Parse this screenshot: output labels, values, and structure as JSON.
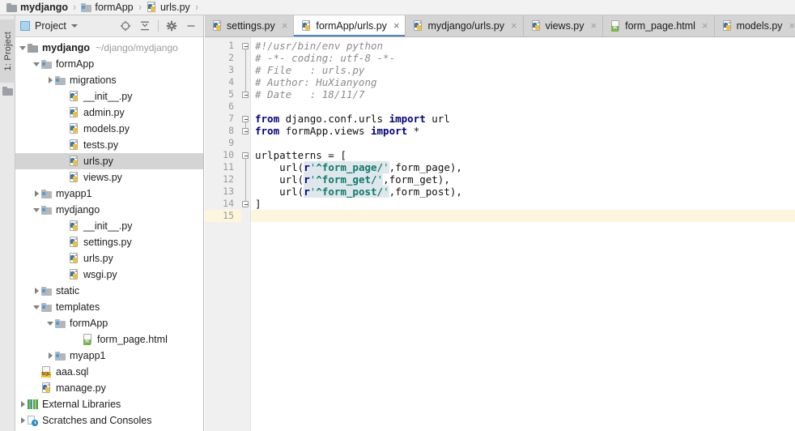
{
  "breadcrumb": {
    "name": "breadcrumb",
    "items": [
      {
        "label": "mydjango",
        "icon": "folder-icon",
        "bold": true
      },
      {
        "label": "formApp",
        "icon": "module-folder-icon",
        "bold": false
      },
      {
        "label": "urls.py",
        "icon": "python-file-icon",
        "bold": false
      }
    ],
    "separator": "›"
  },
  "toolwindow": {
    "vertical_tab_label": "1: Project",
    "vertical_tab_icon": "folder-icon"
  },
  "project_panel": {
    "title": "Project",
    "dropdown_icon": "chevron-down-icon",
    "tools": [
      {
        "name": "locate-icon",
        "title": "Select Opened File"
      },
      {
        "name": "collapse-all-icon",
        "title": "Collapse All"
      },
      {
        "name": "gear-icon",
        "title": "Settings"
      },
      {
        "name": "minimize-icon",
        "title": "Hide"
      }
    ],
    "tree": [
      {
        "indent": 0,
        "arrow": "down",
        "icon": "folder-icon",
        "label": "mydjango",
        "bold": true,
        "path": "~/django/mydjango",
        "selected": false
      },
      {
        "indent": 1,
        "arrow": "down",
        "icon": "module-folder-icon",
        "label": "formApp",
        "bold": false,
        "path": "",
        "selected": false
      },
      {
        "indent": 2,
        "arrow": "right",
        "icon": "module-folder-icon",
        "label": "migrations",
        "bold": false,
        "path": "",
        "selected": false
      },
      {
        "indent": 3,
        "arrow": "none",
        "icon": "python-file-icon",
        "label": "__init__.py",
        "bold": false,
        "path": "",
        "selected": false
      },
      {
        "indent": 3,
        "arrow": "none",
        "icon": "python-file-icon",
        "label": "admin.py",
        "bold": false,
        "path": "",
        "selected": false
      },
      {
        "indent": 3,
        "arrow": "none",
        "icon": "python-file-icon",
        "label": "models.py",
        "bold": false,
        "path": "",
        "selected": false
      },
      {
        "indent": 3,
        "arrow": "none",
        "icon": "python-file-icon",
        "label": "tests.py",
        "bold": false,
        "path": "",
        "selected": false
      },
      {
        "indent": 3,
        "arrow": "none",
        "icon": "python-file-icon",
        "label": "urls.py",
        "bold": false,
        "path": "",
        "selected": true
      },
      {
        "indent": 3,
        "arrow": "none",
        "icon": "python-file-icon",
        "label": "views.py",
        "bold": false,
        "path": "",
        "selected": false
      },
      {
        "indent": 1,
        "arrow": "right",
        "icon": "module-folder-icon",
        "label": "myapp1",
        "bold": false,
        "path": "",
        "selected": false
      },
      {
        "indent": 1,
        "arrow": "down",
        "icon": "module-folder-icon",
        "label": "mydjango",
        "bold": false,
        "path": "",
        "selected": false
      },
      {
        "indent": 3,
        "arrow": "none",
        "icon": "python-file-icon",
        "label": "__init__.py",
        "bold": false,
        "path": "",
        "selected": false
      },
      {
        "indent": 3,
        "arrow": "none",
        "icon": "python-file-icon",
        "label": "settings.py",
        "bold": false,
        "path": "",
        "selected": false
      },
      {
        "indent": 3,
        "arrow": "none",
        "icon": "python-file-icon",
        "label": "urls.py",
        "bold": false,
        "path": "",
        "selected": false
      },
      {
        "indent": 3,
        "arrow": "none",
        "icon": "python-file-icon",
        "label": "wsgi.py",
        "bold": false,
        "path": "",
        "selected": false
      },
      {
        "indent": 1,
        "arrow": "right",
        "icon": "module-folder-icon",
        "label": "static",
        "bold": false,
        "path": "",
        "selected": false
      },
      {
        "indent": 1,
        "arrow": "down",
        "icon": "module-folder-icon",
        "label": "templates",
        "bold": false,
        "path": "",
        "selected": false
      },
      {
        "indent": 2,
        "arrow": "down",
        "icon": "module-folder-icon",
        "label": "formApp",
        "bold": false,
        "path": "",
        "selected": false
      },
      {
        "indent": 4,
        "arrow": "none",
        "icon": "html-file-icon",
        "label": "form_page.html",
        "bold": false,
        "path": "",
        "selected": false
      },
      {
        "indent": 2,
        "arrow": "right",
        "icon": "module-folder-icon",
        "label": "myapp1",
        "bold": false,
        "path": "",
        "selected": false
      },
      {
        "indent": 1,
        "arrow": "none",
        "icon": "sql-file-icon",
        "label": "aaa.sql",
        "bold": false,
        "path": "",
        "selected": false
      },
      {
        "indent": 1,
        "arrow": "none",
        "icon": "python-file-icon",
        "label": "manage.py",
        "bold": false,
        "path": "",
        "selected": false
      },
      {
        "indent": 0,
        "arrow": "right",
        "icon": "library-icon",
        "label": "External Libraries",
        "bold": false,
        "path": "",
        "selected": false
      },
      {
        "indent": 0,
        "arrow": "right",
        "icon": "scratches-icon",
        "label": "Scratches and Consoles",
        "bold": false,
        "path": "",
        "selected": false
      }
    ]
  },
  "editor": {
    "tabs": [
      {
        "label": "settings.py",
        "icon": "python-file-icon",
        "active": false,
        "close_icon": "close-icon"
      },
      {
        "label": "formApp/urls.py",
        "icon": "python-file-icon",
        "active": true,
        "close_icon": "close-icon"
      },
      {
        "label": "mydjango/urls.py",
        "icon": "python-file-icon",
        "active": false,
        "close_icon": "close-icon"
      },
      {
        "label": "views.py",
        "icon": "python-file-icon",
        "active": false,
        "close_icon": "close-icon"
      },
      {
        "label": "form_page.html",
        "icon": "html-file-icon",
        "active": false,
        "close_icon": "close-icon"
      },
      {
        "label": "models.py",
        "icon": "python-file-icon",
        "active": false,
        "close_icon": "close-icon"
      }
    ],
    "close_glyph": "×",
    "current_line": 15,
    "line_numbers": [
      1,
      2,
      3,
      4,
      5,
      6,
      7,
      8,
      9,
      10,
      11,
      12,
      13,
      14,
      15
    ],
    "fold_markers": [
      {
        "line": 1,
        "type": "box"
      },
      {
        "line": 5,
        "type": "box-end"
      },
      {
        "line": 7,
        "type": "box"
      },
      {
        "line": 8,
        "type": "box-end"
      },
      {
        "line": 10,
        "type": "box"
      },
      {
        "line": 14,
        "type": "box-end"
      }
    ],
    "lines": [
      {
        "n": 1,
        "tokens": [
          {
            "t": "comment",
            "v": "#!/usr/bin/env python"
          }
        ]
      },
      {
        "n": 2,
        "tokens": [
          {
            "t": "comment",
            "v": "# -*- coding: utf-8 -*-"
          }
        ]
      },
      {
        "n": 3,
        "tokens": [
          {
            "t": "comment",
            "v": "# File   : urls.py"
          }
        ]
      },
      {
        "n": 4,
        "tokens": [
          {
            "t": "comment",
            "v": "# Author: HuXianyong"
          }
        ]
      },
      {
        "n": 5,
        "tokens": [
          {
            "t": "comment",
            "v": "# Date   : 18/11/7"
          }
        ]
      },
      {
        "n": 6,
        "tokens": []
      },
      {
        "n": 7,
        "tokens": [
          {
            "t": "kw",
            "v": "from"
          },
          {
            "t": "plain",
            "v": " django.conf.urls "
          },
          {
            "t": "kw",
            "v": "import"
          },
          {
            "t": "plain",
            "v": " url"
          }
        ]
      },
      {
        "n": 8,
        "tokens": [
          {
            "t": "kw",
            "v": "from"
          },
          {
            "t": "plain",
            "v": " formApp.views "
          },
          {
            "t": "kw",
            "v": "import"
          },
          {
            "t": "plain",
            "v": " *"
          }
        ]
      },
      {
        "n": 9,
        "tokens": []
      },
      {
        "n": 10,
        "tokens": [
          {
            "t": "plain",
            "v": "urlpatterns = ["
          }
        ]
      },
      {
        "n": 11,
        "tokens": [
          {
            "t": "plain",
            "v": "    url("
          },
          {
            "t": "pfx",
            "v": "r"
          },
          {
            "t": "rxq",
            "v": "'"
          },
          {
            "t": "rx",
            "v": "^form_page/"
          },
          {
            "t": "rxq",
            "v": "'"
          },
          {
            "t": "plain",
            "v": ",form_page),"
          }
        ]
      },
      {
        "n": 12,
        "tokens": [
          {
            "t": "plain",
            "v": "    url("
          },
          {
            "t": "pfx",
            "v": "r"
          },
          {
            "t": "rxq",
            "v": "'"
          },
          {
            "t": "rx",
            "v": "^form_get/"
          },
          {
            "t": "rxq",
            "v": "'"
          },
          {
            "t": "plain",
            "v": ",form_get),"
          }
        ]
      },
      {
        "n": 13,
        "tokens": [
          {
            "t": "plain",
            "v": "    url("
          },
          {
            "t": "pfx",
            "v": "r"
          },
          {
            "t": "rxq",
            "v": "'"
          },
          {
            "t": "rx",
            "v": "^form_post/"
          },
          {
            "t": "rxq",
            "v": "'"
          },
          {
            "t": "plain",
            "v": ",form_post),"
          }
        ]
      },
      {
        "n": 14,
        "tokens": [
          {
            "t": "plain",
            "v": "]"
          }
        ]
      },
      {
        "n": 15,
        "tokens": []
      }
    ]
  },
  "colors": {
    "accent": "#4a86c8",
    "keyword": "#000080",
    "comment": "#8c8c8c",
    "string": "#008080",
    "regex": "#0c7c6b",
    "regex_bg": "#dfe6ec",
    "caret_line": "#fdf6dd",
    "selection": "#d4d4d4",
    "tabbar_bg": "#d4d4d4",
    "panel_bg": "#ececec"
  }
}
